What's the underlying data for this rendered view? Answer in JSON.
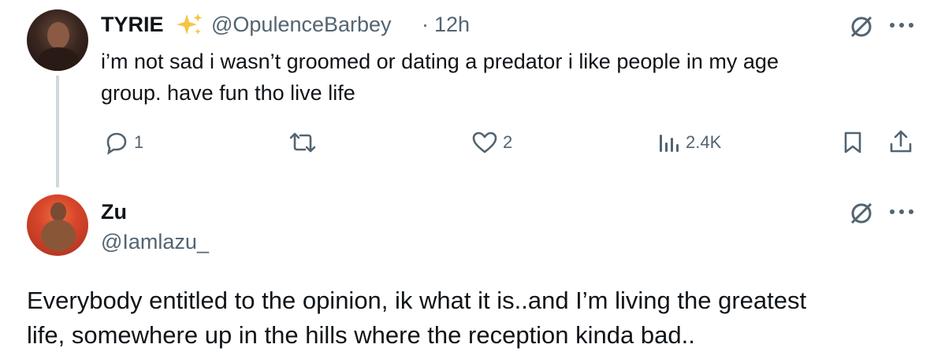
{
  "tweet1": {
    "display_name": "TYRIE",
    "verified_badge": "sparkles-icon",
    "handle": "@OpulenceBarbey",
    "separator": "·",
    "time": "12h",
    "text_line1": "i’m not sad i wasn’t groomed or dating a predator i like people in my age",
    "text_line2": "group. have fun tho live life",
    "actions": {
      "reply_count": "1",
      "retweet_count": "",
      "like_count": "2",
      "view_count": "2.4K"
    }
  },
  "tweet2": {
    "display_name": "Zu",
    "handle": "@Iamlazu_",
    "text_line1": "Everybody entitled to the opinion, ik what it is..and I’m living the greatest",
    "text_line2": "life, somewhere up in the hills where the reception kinda bad.."
  },
  "icons": {
    "grok": "grok-icon",
    "more": "more-icon",
    "reply": "reply-icon",
    "retweet": "retweet-icon",
    "like": "heart-icon",
    "views": "views-icon",
    "bookmark": "bookmark-icon",
    "share": "share-icon"
  },
  "colors": {
    "text": "#0f1419",
    "muted": "#536471",
    "thread_line": "#cfd9de",
    "badge": "#f5c542"
  }
}
